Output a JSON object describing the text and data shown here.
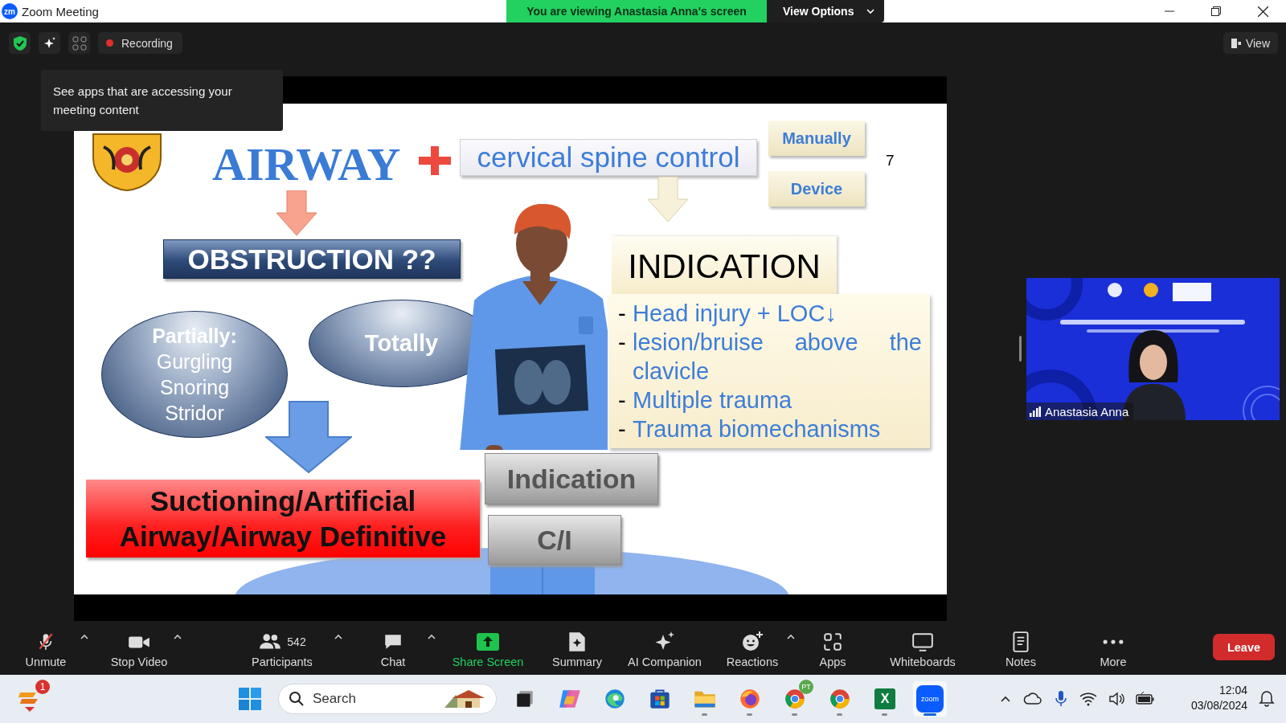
{
  "window": {
    "title": "Zoom Meeting",
    "app_badge": "zm"
  },
  "share_banner": {
    "text": "You are viewing Anastasia Anna's screen",
    "view_options": "View Options"
  },
  "meeting_bar": {
    "recording": "Recording",
    "view": "View"
  },
  "tooltip": {
    "text": "See apps that are accessing your meeting content"
  },
  "slide": {
    "title": "AIRWAY",
    "spine": "cervical spine control",
    "options": [
      "Manually",
      "Device"
    ],
    "page_number": "7",
    "obstruction": "OBSTRUCTION ??",
    "partial": {
      "heading": "Partially:",
      "lines": [
        "Gurgling",
        "Snoring",
        "Stridor"
      ]
    },
    "total": "Totally",
    "action": [
      "Suctioning/Artificial",
      "Airway/Airway Definitive"
    ],
    "indication_heading": "INDICATION",
    "indications": [
      {
        "bullet": "-",
        "text": "Head injury + LOC↓"
      },
      {
        "bullet": "-",
        "text": "lesion/bruise above the clavicle"
      },
      {
        "bullet": "-",
        "text": "Multiple trauma"
      },
      {
        "bullet": "-",
        "text": "Trauma biomechanisms"
      }
    ],
    "buttons": [
      "Indication",
      "C/I"
    ]
  },
  "video": {
    "kind": "picture",
    "name": "Anastasia Anna"
  },
  "toolbar": [
    {
      "kind": "mic",
      "label": "Unmute",
      "muted": true,
      "caret": true
    },
    {
      "kind": "video",
      "label": "Stop Video",
      "caret": true
    },
    {
      "kind": "participants",
      "label": "Participants",
      "count": "542",
      "caret": true
    },
    {
      "kind": "chat",
      "label": "Chat",
      "caret": true
    },
    {
      "kind": "share",
      "label": "Share Screen",
      "caret": false
    },
    {
      "kind": "summary",
      "label": "Summary",
      "caret": false
    },
    {
      "kind": "ai",
      "label": "AI Companion",
      "caret": false
    },
    {
      "kind": "reactions",
      "label": "Reactions",
      "caret": true
    },
    {
      "kind": "apps",
      "label": "Apps",
      "caret": false
    },
    {
      "kind": "whiteboards",
      "label": "Whiteboards",
      "caret": false
    },
    {
      "kind": "notes",
      "label": "Notes",
      "caret": false
    },
    {
      "kind": "more",
      "label": "More",
      "caret": false
    }
  ],
  "leave": "Leave",
  "taskbar": {
    "widget_badge": "1",
    "search_placeholder": "Search",
    "apps": [
      {
        "kind": "taskview",
        "running": false,
        "active": false
      },
      {
        "kind": "copilot",
        "running": false,
        "active": false
      },
      {
        "kind": "edge",
        "running": false,
        "active": false
      },
      {
        "kind": "store",
        "running": false,
        "active": false
      },
      {
        "kind": "explorer",
        "running": true,
        "active": false
      },
      {
        "kind": "firefox",
        "running": true,
        "active": false
      },
      {
        "kind": "chrome",
        "running": true,
        "active": false,
        "badge": "PT"
      },
      {
        "kind": "chrome",
        "running": true,
        "active": false
      },
      {
        "kind": "excel",
        "running": true,
        "active": false,
        "label": "X"
      },
      {
        "kind": "zoom",
        "running": true,
        "active": true,
        "label": "zoom"
      }
    ],
    "clock": {
      "time": "12:04",
      "date": "03/08/2024"
    }
  }
}
